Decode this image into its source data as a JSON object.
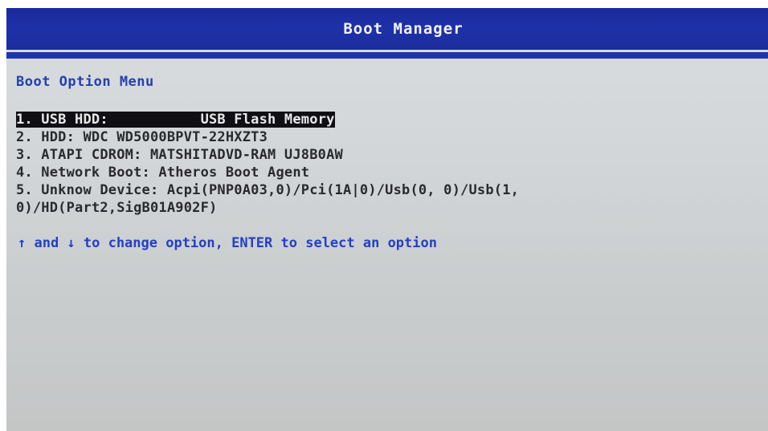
{
  "window": {
    "title": "Boot Manager"
  },
  "menu": {
    "heading": "Boot Option Menu",
    "options": [
      {
        "label": "1. USB HDD:           USB Flash Memory",
        "selected": true
      },
      {
        "label": "2. HDD: WDC WD5000BPVT-22HXZT3",
        "selected": false
      },
      {
        "label": "3. ATAPI CDROM: MATSHITADVD-RAM UJ8B0AW",
        "selected": false
      },
      {
        "label": "4. Network Boot: Atheros Boot Agent",
        "selected": false
      },
      {
        "label": "5. Unknow Device: Acpi(PNP0A03,0)/Pci(1A|0)/Usb(0, 0)/Usb(1,",
        "selected": false
      },
      {
        "label": "0)/HD(Part2,SigB01A902F)",
        "selected": false
      }
    ]
  },
  "footer": {
    "hint": "↑ and ↓ to change option, ENTER to select an option"
  },
  "colors": {
    "title_bar": "#1e31a8",
    "accent_text": "#2440b0",
    "selection_bg": "#101014",
    "screen_bg": "#d2d6d8"
  }
}
